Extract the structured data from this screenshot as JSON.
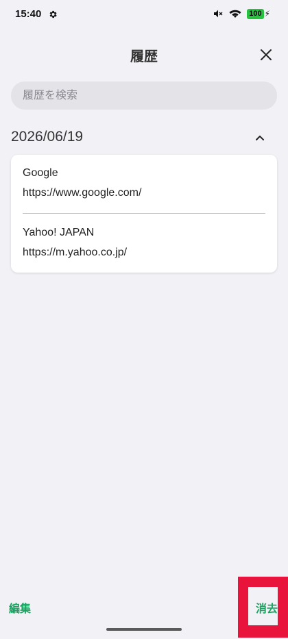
{
  "status_bar": {
    "time": "15:40",
    "battery": "100"
  },
  "header": {
    "title": "履歴"
  },
  "search": {
    "placeholder": "履歴を検索",
    "value": ""
  },
  "history_group": {
    "date": "2026/06/19",
    "items": [
      {
        "title": "Google",
        "url": "https://www.google.com/"
      },
      {
        "title": "Yahoo! JAPAN",
        "url": "https://m.yahoo.co.jp/"
      }
    ]
  },
  "toolbar": {
    "edit_label": "編集",
    "delete_label": "消去"
  },
  "colors": {
    "accent": "#1aa260",
    "highlight": "#e8143c",
    "background": "#f2f1f6"
  },
  "icons": {
    "settings": "gear-icon",
    "mute": "mute-icon",
    "wifi": "wifi-icon",
    "battery": "battery-icon",
    "close": "close-icon",
    "collapse": "chevron-up-icon"
  }
}
